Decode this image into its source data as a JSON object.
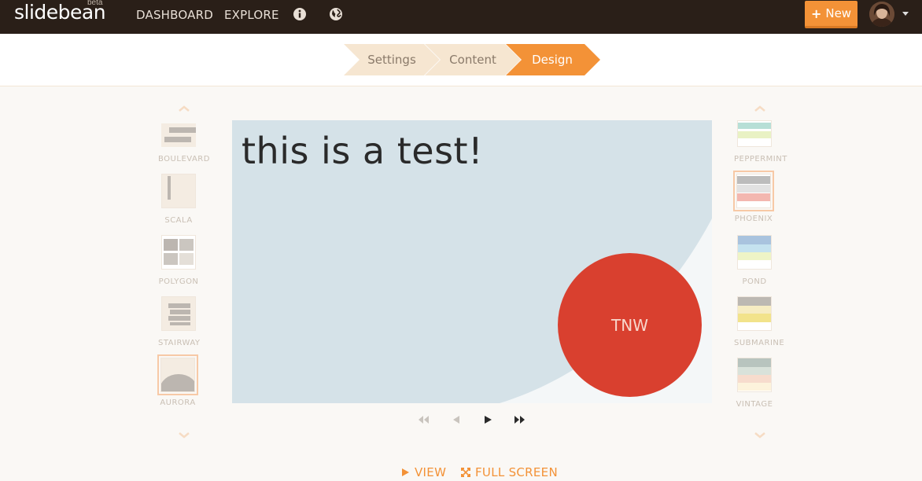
{
  "brand": {
    "name": "slidebean",
    "badge": "beta"
  },
  "nav": {
    "dashboard": "DASHBOARD",
    "explore": "EXPLORE",
    "new_button": "New"
  },
  "steps": [
    {
      "label": "Settings",
      "state": "done"
    },
    {
      "label": "Content",
      "state": "done"
    },
    {
      "label": "Design",
      "state": "active"
    }
  ],
  "themes_left": [
    {
      "name": "BOULEVARD"
    },
    {
      "name": "SCALA"
    },
    {
      "name": "POLYGON"
    },
    {
      "name": "STAIRWAY"
    },
    {
      "name": "AURORA",
      "selected": true
    }
  ],
  "themes_right": [
    {
      "name": "PEPPERMINT"
    },
    {
      "name": "PHOENIX",
      "selected": true
    },
    {
      "name": "POND"
    },
    {
      "name": "SUBMARINE"
    },
    {
      "name": "VINTAGE"
    }
  ],
  "slide": {
    "title": "this is a test!",
    "circle_text": "TNW"
  },
  "actions": {
    "view": "VIEW",
    "fullscreen": "FULL SCREEN"
  },
  "colors": {
    "accent": "#f39237",
    "topbar": "#2a1f18",
    "slide_bg": "#d5e2e8",
    "circle": "#d9402f"
  }
}
